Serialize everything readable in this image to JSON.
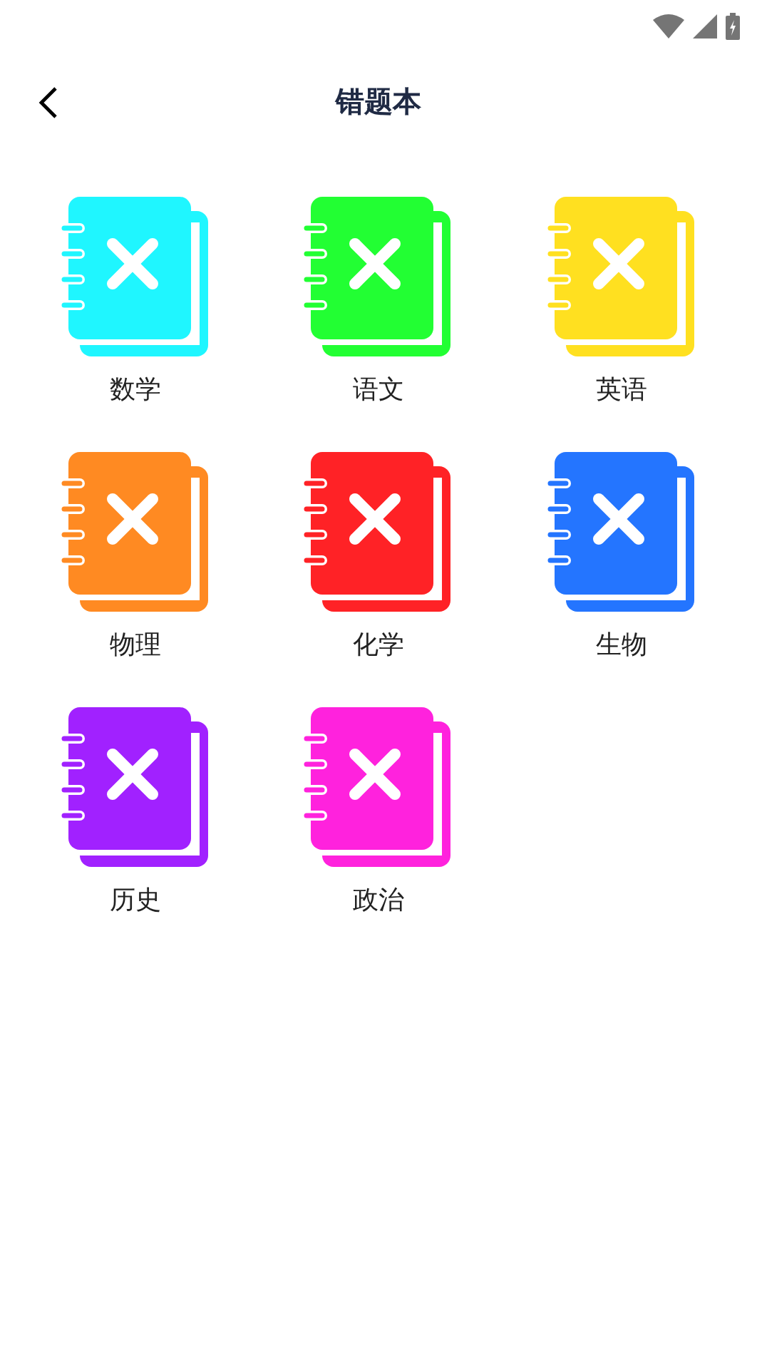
{
  "header": {
    "title": "错题本"
  },
  "subjects": [
    {
      "label": "数学",
      "color": "#1ff6ff"
    },
    {
      "label": "语文",
      "color": "#22ff33"
    },
    {
      "label": "英语",
      "color": "#ffe020"
    },
    {
      "label": "物理",
      "color": "#ff8a22"
    },
    {
      "label": "化学",
      "color": "#ff2226"
    },
    {
      "label": "生物",
      "color": "#2475ff"
    },
    {
      "label": "历史",
      "color": "#a121ff"
    },
    {
      "label": "政治",
      "color": "#ff22dd"
    }
  ]
}
